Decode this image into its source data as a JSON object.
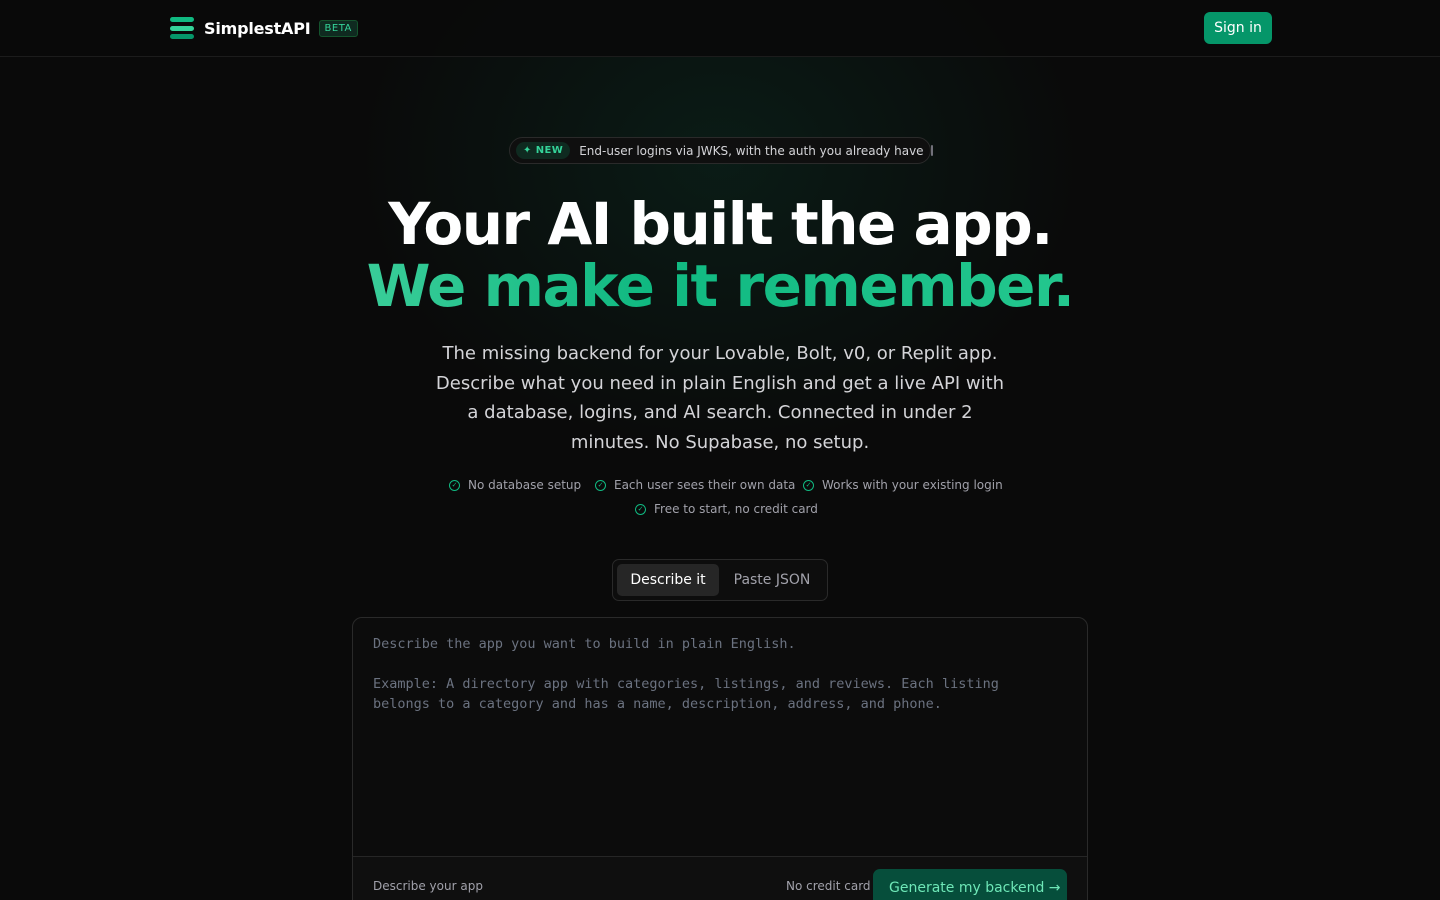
{
  "header": {
    "brand": "SimplestAPI",
    "badge": "BETA",
    "signin_label": "Sign in"
  },
  "announcement": {
    "tag": "NEW",
    "text": "End-user logins via JWKS, with the auth you already have"
  },
  "hero": {
    "line1": "Your AI built the app.",
    "line2": "We make it remember.",
    "subtitle": "The missing backend for your Lovable, Bolt, v0, or Replit app. Describe what you need in plain English and get a live API with a database, logins, and AI search. Connected in under 2 minutes. No Supabase, no setup."
  },
  "features": [
    "No database setup",
    "Each user sees their own data",
    "Works with your existing login",
    "Free to start, no credit card"
  ],
  "tabs": [
    {
      "label": "Describe it",
      "active": true
    },
    {
      "label": "Paste JSON",
      "active": false
    }
  ],
  "editor": {
    "placeholder": "Describe the app you want to build in plain English.\n\nExample: A directory app with categories, listings, and reviews. Each listing\nbelongs to a category and has a name, description, address, and phone.",
    "hint": "Describe your app",
    "note": "No credit card",
    "submit_label": "Generate my backend →"
  },
  "colors": {
    "accent": "#10b981",
    "background": "#0a0a0a"
  }
}
